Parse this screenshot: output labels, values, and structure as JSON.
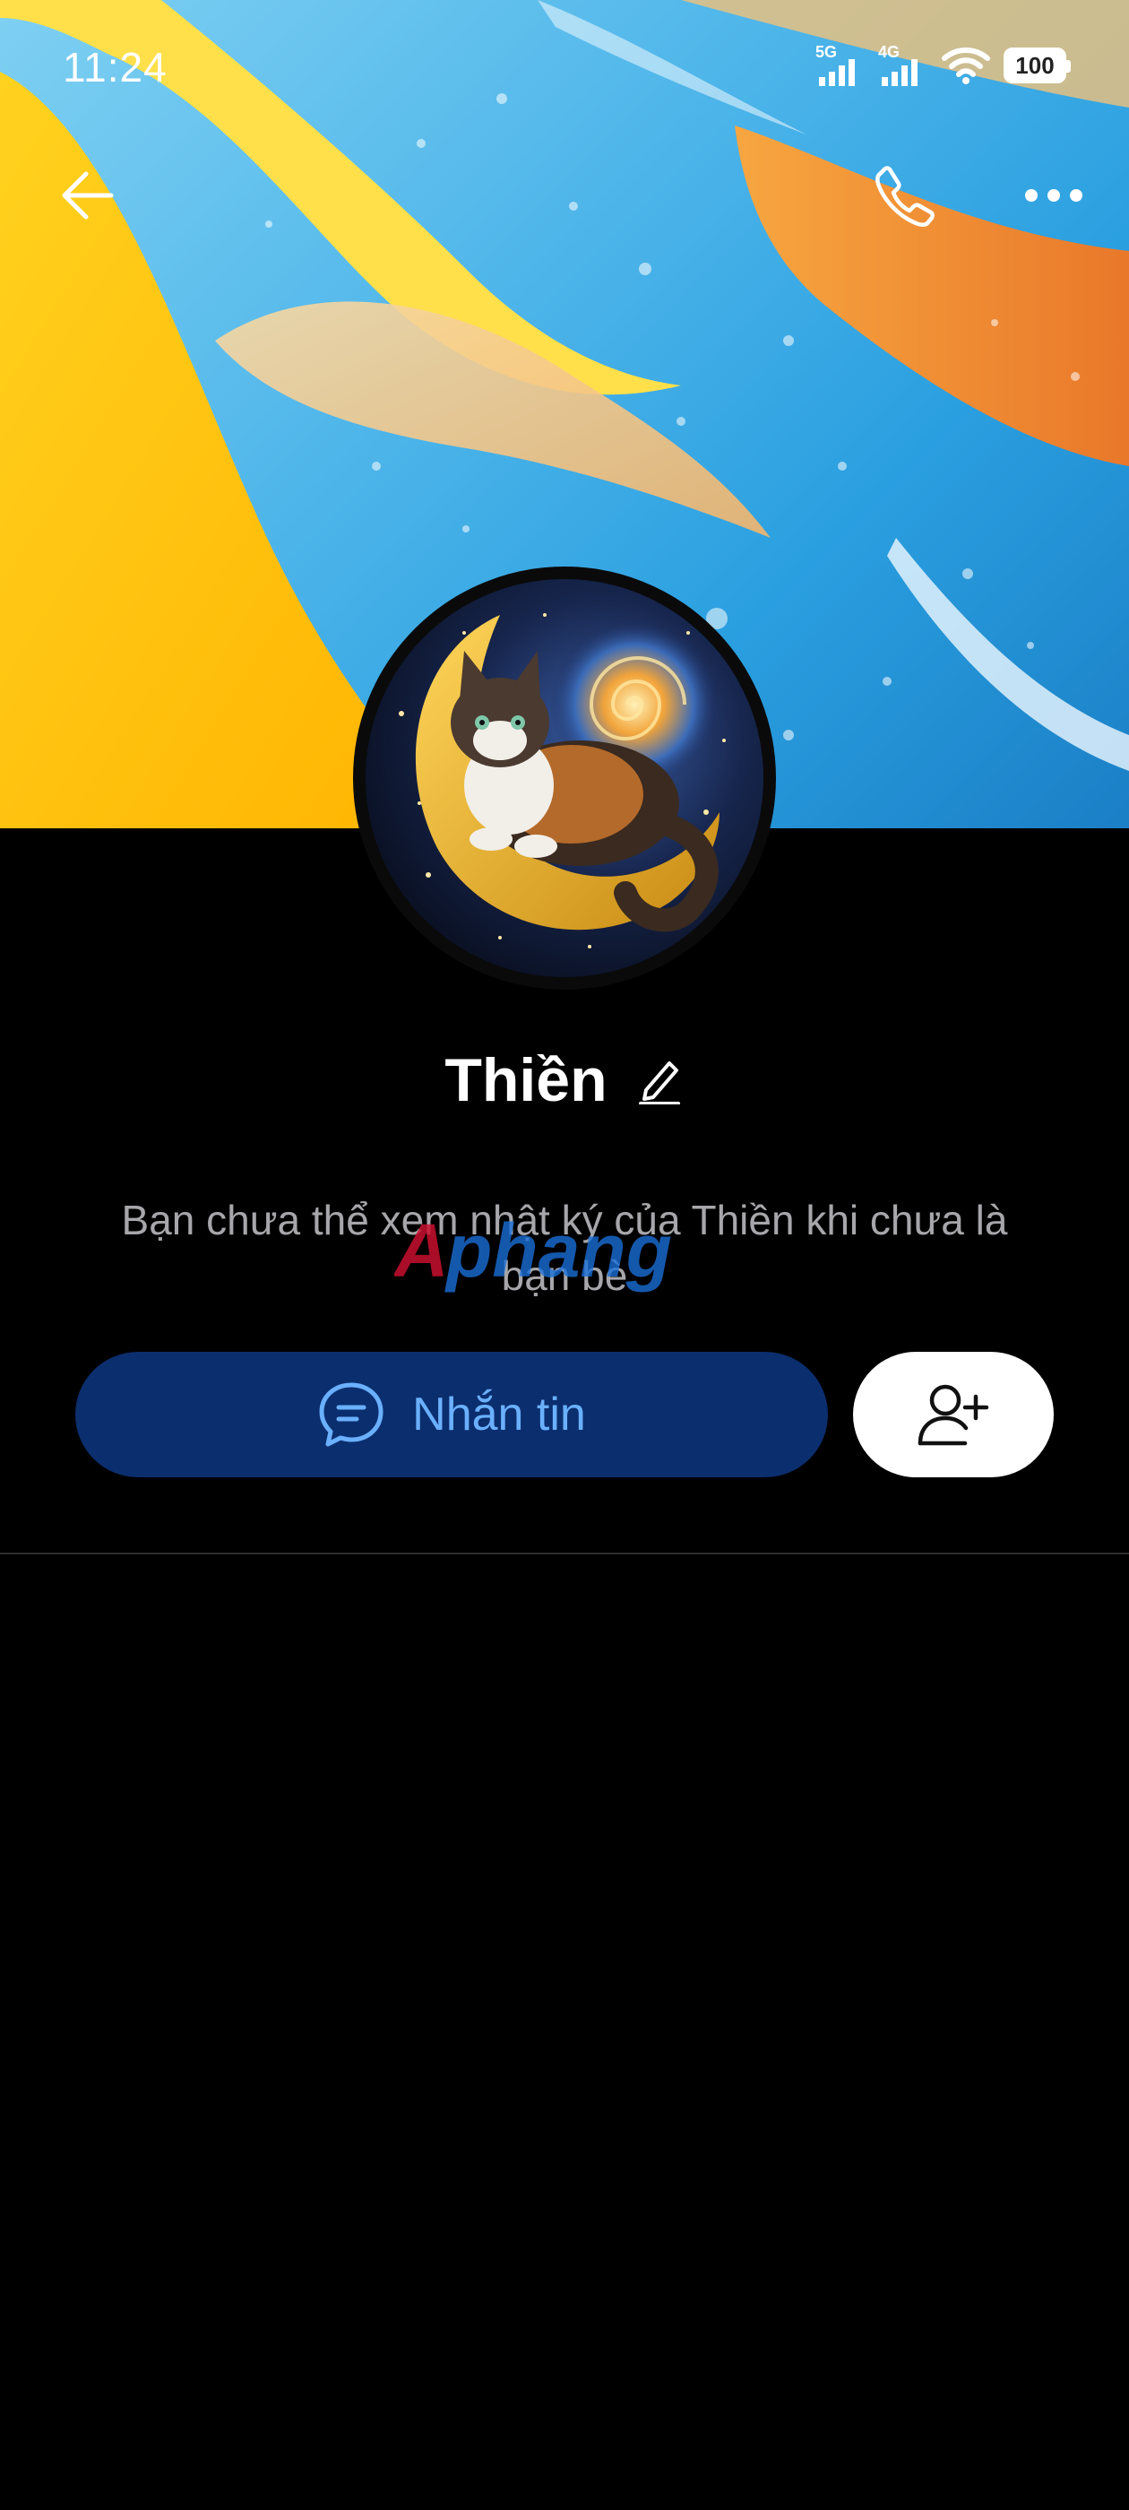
{
  "status_bar": {
    "time": "11:24",
    "network_1": "5G",
    "network_2": "4G",
    "battery": "100"
  },
  "header": {
    "back_icon": "back-arrow-icon",
    "call_icon": "phone-icon",
    "more_icon": "more-dots-icon"
  },
  "profile": {
    "name": "Thiền",
    "edit_icon": "pencil-icon",
    "privacy_notice": "Bạn chưa thể xem nhật ký của Thiền khi chưa là bạn bè",
    "watermark": "Aphang"
  },
  "actions": {
    "message_label": "Nhắn tin",
    "message_icon": "chat-bubble-icon",
    "add_friend_icon": "add-friend-icon"
  },
  "colors": {
    "message_button_bg": "#0b2e6e",
    "message_button_text": "#6ab0ff",
    "page_background": "#000000"
  }
}
